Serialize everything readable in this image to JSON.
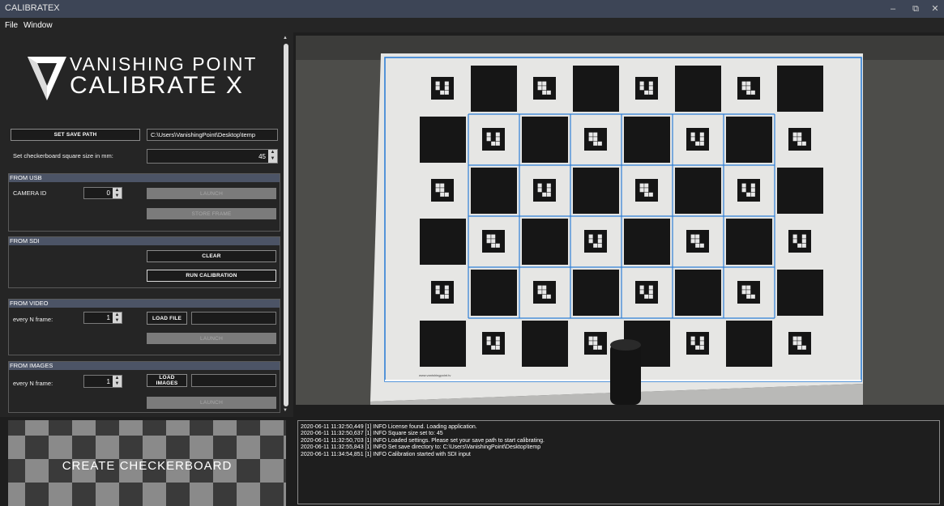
{
  "window": {
    "title": "CALIBRATEX",
    "controls": {
      "minimize": "–",
      "restore": "⧉",
      "close": "✕"
    }
  },
  "menu": {
    "items": [
      "File",
      "Window"
    ]
  },
  "logo": {
    "line1": "VANISHING POINT",
    "line2": "CALIBRATE X",
    "icon": "v-logo-icon"
  },
  "settings": {
    "save_path_button": "SET SAVE PATH",
    "save_path_value": "C:\\Users\\VanishingPoint\\Desktop\\temp",
    "square_size_label": "Set checkerboard square size in mm:",
    "square_size_value": "45"
  },
  "usb": {
    "header": "FROM USB",
    "camera_id_label": "CAMERA ID",
    "camera_id_value": "0",
    "launch_button": "LAUNCH",
    "store_frame_button": "STORE FRAME"
  },
  "sdi": {
    "header": "FROM SDI",
    "clear_button": "CLEAR",
    "run_button": "RUN CALIBRATION"
  },
  "video": {
    "header": "FROM VIDEO",
    "n_label": "every N frame:",
    "n_value": "1",
    "load_button": "LOAD FILE",
    "file_value": "",
    "launch_button": "LAUNCH"
  },
  "images": {
    "header": "FROM IMAGES",
    "n_label": "every N frame:",
    "n_value": "1",
    "load_button": "LOAD IMAGES",
    "file_value": "",
    "launch_button": "LAUNCH"
  },
  "checkerboard_button": "CREATE CHECKERBOARD",
  "log": [
    "2020-06-11 11:32:50,449 [1] INFO  License found. Loading application.",
    "2020-06-11 11:32:50,637 [1] INFO  Square size set to: 45",
    "2020-06-11 11:32:50,703 [1] INFO  Loaded settings. Please set your save path to start calibrating.",
    "2020-06-11 11:32:55,843 [1] INFO  Set save directory to: C:\\Users\\VanishingPoint\\Desktop\\temp",
    "2020-06-11 11:34:54,851 [1] INFO  Calibration started with SDI input"
  ],
  "camera": {
    "board_caption": "www.vanishingpoint.tv",
    "detection_color": "#2f7fd6"
  },
  "colors": {
    "titlebar": "#3d4556",
    "section_header": "#4c5466",
    "panel": "#252525"
  }
}
